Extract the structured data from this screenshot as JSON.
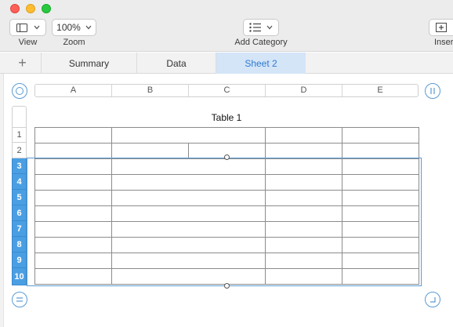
{
  "toolbar": {
    "view_label": "View",
    "zoom_value": "100%",
    "zoom_label": "Zoom",
    "add_category_label": "Add Category",
    "insert_label": "Insert"
  },
  "tabs": [
    {
      "label": "Summary"
    },
    {
      "label": "Data"
    },
    {
      "label": "Sheet 2"
    }
  ],
  "table": {
    "title": "Table 1",
    "columns": [
      "A",
      "B",
      "C",
      "D",
      "E"
    ],
    "rows": [
      "1",
      "2",
      "3",
      "4",
      "5",
      "6",
      "7",
      "8",
      "9",
      "10"
    ],
    "selected_rows": [
      "3",
      "4",
      "5",
      "6",
      "7",
      "8",
      "9",
      "10"
    ]
  },
  "colors": {
    "accent": "#4a9fe3",
    "tab_active_bg": "#d4e5f8",
    "tab_active_text": "#2f7ad0"
  }
}
